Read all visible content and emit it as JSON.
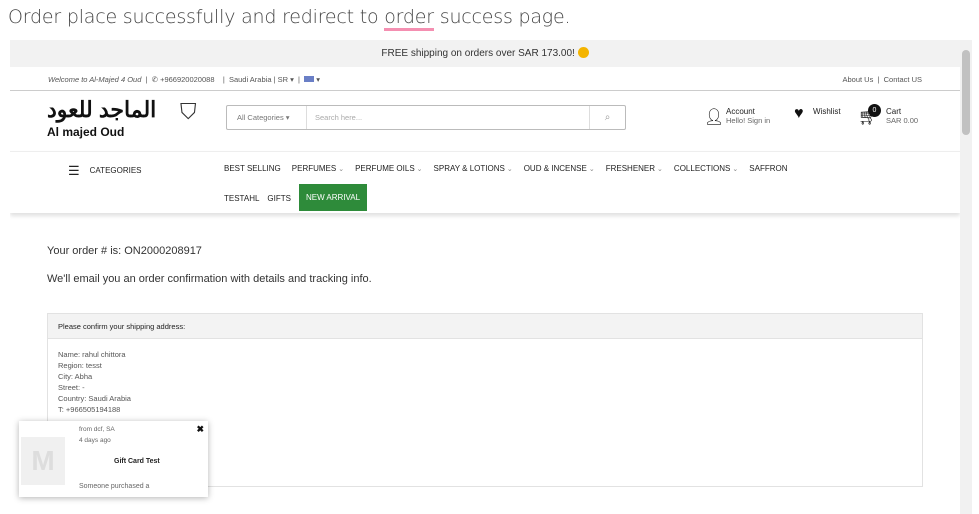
{
  "caption": {
    "before": "Order place successfully and redirect to ",
    "highlight": "order",
    "after": " success page."
  },
  "promo": {
    "text": "FREE shipping on orders over SAR 173.00!"
  },
  "topbar": {
    "welcome": "Welcome to Al-Majed 4 Oud",
    "phone": "+966920020088",
    "region": "Saudi Arabia | SR",
    "about": "About Us",
    "contact": "Contact US"
  },
  "header": {
    "logo_ar": "الماجد للعود",
    "logo_en": "Al majed Oud",
    "search_category": "All Categories",
    "search_placeholder": "Search here...",
    "account_label": "Account",
    "account_sub": "Hello! Sign in",
    "wishlist": "Wishlist",
    "cart_label": "Cart",
    "cart_total": "SAR 0.00",
    "cart_count": "0"
  },
  "nav": {
    "categories": "CATEGORIES",
    "items": [
      "BEST SELLING",
      "PERFUMES",
      "PERFUME OILS",
      "SPRAY & LOTIONS",
      "OUD & INCENSE",
      "FRESHENER",
      "COLLECTIONS",
      "SAFFRON"
    ],
    "row2": [
      "TESTAHL",
      "GIFTS"
    ],
    "new_arrival": "NEW ARRIVAL",
    "accent": "#2e8b3a"
  },
  "order": {
    "number": "Your order # is: ON2000208917",
    "email": "We'll email you an order confirmation with details and tracking info."
  },
  "shipping": {
    "heading": "Please confirm your shipping address:",
    "lines": [
      "Name: rahul chittora",
      "Region: tesst",
      "City: Abha",
      "Street: -",
      "Country: Saudi Arabia",
      "T: +966505194188"
    ]
  },
  "popup": {
    "from": "from dcf, SA",
    "ago": "4 days ago",
    "product": "Gift Card Test",
    "text": "Someone purchased a"
  }
}
